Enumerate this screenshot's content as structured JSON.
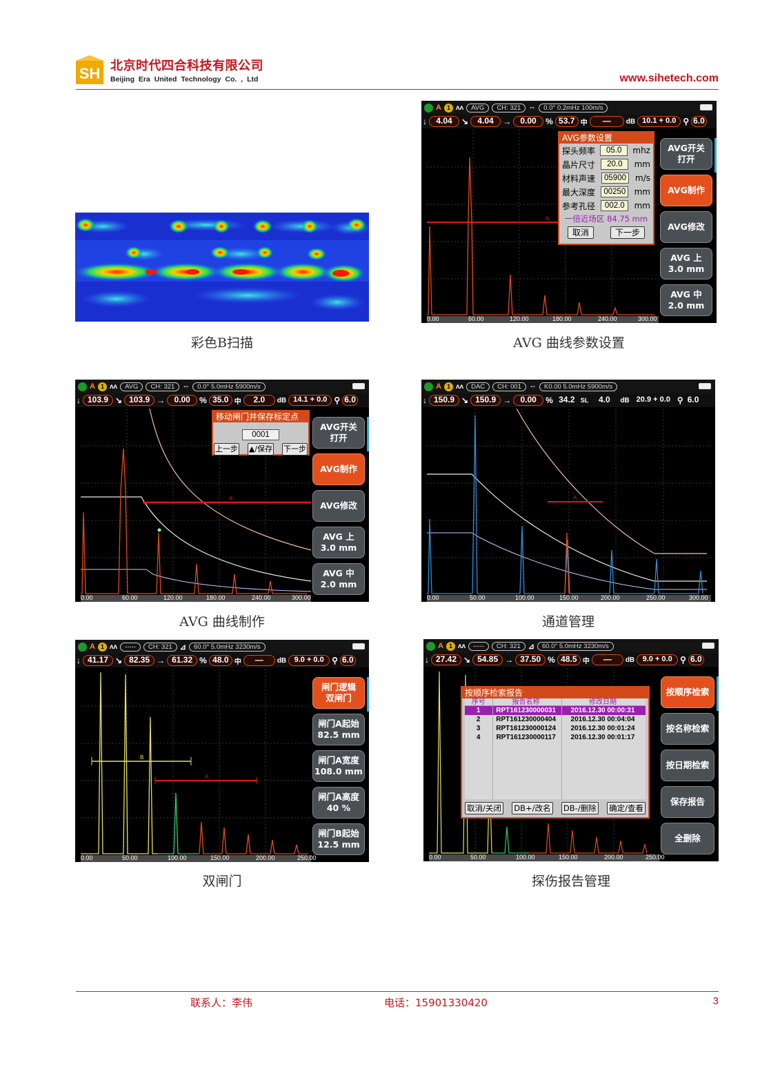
{
  "header": {
    "company_cn": "北京时代四合科技有限公司",
    "company_en": "Beijing Era United Technology Co. , Ltd",
    "logo_text": "SH",
    "website": "www.sihetech.com"
  },
  "captions": {
    "bscan": "彩色B扫描",
    "avg_params": "AVG 曲线参数设置",
    "avg_make": "AVG 曲线制作",
    "channel": "通道管理",
    "dual_gate": "双闸门",
    "report": "探伤报告管理"
  },
  "screens": {
    "avg_params": {
      "status": {
        "mode": "A",
        "num": "1",
        "curve": "AVG",
        "ch": "CH: 321",
        "probe": "0.0°  0.2mHz  100m/s"
      },
      "measures": [
        "4.04",
        "4.04",
        "0.00",
        "53.7",
        "—",
        "10.1 + 0.0",
        "6.0"
      ],
      "menu": [
        [
          "AVG开关",
          "打开"
        ],
        [
          "AVG制作",
          ""
        ],
        [
          "AVG修改",
          ""
        ],
        [
          "AVG 上",
          "3.0 mm"
        ],
        [
          "AVG 中",
          "2.0 mm"
        ]
      ],
      "xaxis": [
        "0.00",
        "60.00",
        "120.00",
        "180.00",
        "240.00",
        "300.00"
      ],
      "dialog": {
        "title": "AVG参数设置",
        "rows": [
          {
            "label": "探头频率",
            "value": "05.0",
            "unit": "mhz"
          },
          {
            "label": "晶片尺寸",
            "value": "20.0",
            "unit": "mm"
          },
          {
            "label": "材料声速",
            "value": "05900",
            "unit": "m/s"
          },
          {
            "label": "最大深度",
            "value": "00250",
            "unit": "mm"
          },
          {
            "label": "参考孔径",
            "value": "002.0",
            "unit": "mm"
          }
        ],
        "nearfield": "一倍近场区  84.75 mm",
        "cancel": "取消",
        "next": "下一步"
      }
    },
    "avg_make": {
      "status": {
        "mode": "A",
        "num": "1",
        "curve": "AVG",
        "ch": "CH: 321",
        "probe": "0.0°  5.0mHz  5900m/s"
      },
      "measures": [
        "103.9",
        "103.9",
        "0.00",
        "35.0",
        "2.0",
        "14.1 + 0.0",
        "6.0"
      ],
      "menu": [
        [
          "AVG开关",
          "打开"
        ],
        [
          "AVG制作",
          ""
        ],
        [
          "AVG修改",
          ""
        ],
        [
          "AVG 上",
          "3.0 mm"
        ],
        [
          "AVG 中",
          "2.0 mm"
        ]
      ],
      "xaxis": [
        "0.00",
        "60.00",
        "120.00",
        "180.00",
        "240.00",
        "300.00"
      ],
      "dialog": {
        "title": "移动闸门并保存标定点",
        "value": "0001",
        "prev": "上一步",
        "save": "▲/保存",
        "next": "下一步"
      }
    },
    "channel": {
      "status": {
        "mode": "A",
        "num": "1",
        "curve": "DAC",
        "ch": "CH: 001",
        "probe": "K0.00  5.0mHz  5900m/s"
      },
      "measures": [
        "150.9",
        "150.9",
        "0.00",
        "34.2",
        "4.0",
        "20.9 + 0.0",
        "6.0"
      ],
      "xaxis": [
        "0.00",
        "50.00",
        "100.00",
        "150.00",
        "200.00",
        "250.00",
        "300.00"
      ]
    },
    "dual_gate": {
      "status": {
        "mode": "A",
        "num": "1",
        "curve": "-----",
        "ch": "CH: 321",
        "probe": "60.0°  5.0mHz  3230m/s"
      },
      "measures": [
        "41.17",
        "82.35",
        "61.32",
        "48.0",
        "—",
        "9.0 + 0.0",
        "6.0"
      ],
      "menu": [
        [
          "闸门逻辑",
          "双闸门"
        ],
        [
          "闸门A起始",
          "82.5 mm"
        ],
        [
          "闸门A宽度",
          "108.0 mm"
        ],
        [
          "闸门A高度",
          "40 %"
        ],
        [
          "闸门B起始",
          "12.5 mm"
        ]
      ],
      "xaxis": [
        "0.00",
        "50.00",
        "100.00",
        "150.00",
        "200.00",
        "250.00"
      ]
    },
    "report": {
      "status": {
        "mode": "A",
        "num": "1",
        "curve": "-----",
        "ch": "CH: 321",
        "probe": "60.0°  5.0mHz  3230m/s"
      },
      "measures": [
        "27.42",
        "54.85",
        "37.50",
        "48.5",
        "—",
        "9.0 + 0.0",
        "6.0"
      ],
      "menu": [
        [
          "按顺序检索",
          ""
        ],
        [
          "按名称检索",
          ""
        ],
        [
          "按日期检索",
          ""
        ],
        [
          "保存报告",
          ""
        ],
        [
          "全删除",
          ""
        ]
      ],
      "xaxis": [
        "0.00",
        "50.00",
        "100.00",
        "150.00",
        "200.00",
        "250.00"
      ],
      "dialog": {
        "title": "按顺序检索报告",
        "cols": [
          "序号",
          "报告名称",
          "修改日期"
        ],
        "rows": [
          [
            "1",
            "RPT161230000031",
            "2016.12.30  00:00:31"
          ],
          [
            "2",
            "RPT161230000404",
            "2016.12.30  00:04:04"
          ],
          [
            "3",
            "RPT161230000124",
            "2016.12.30  00:01:24"
          ],
          [
            "4",
            "RPT161230000117",
            "2016.12.30  00:01:17"
          ]
        ],
        "buttons": [
          "取消/关闭",
          "DB+/改名",
          "DB-/删除",
          "确定/查看"
        ]
      }
    }
  },
  "footer": {
    "contact": "联系人：李伟",
    "phone": "电话：15901330420",
    "page": "3"
  }
}
